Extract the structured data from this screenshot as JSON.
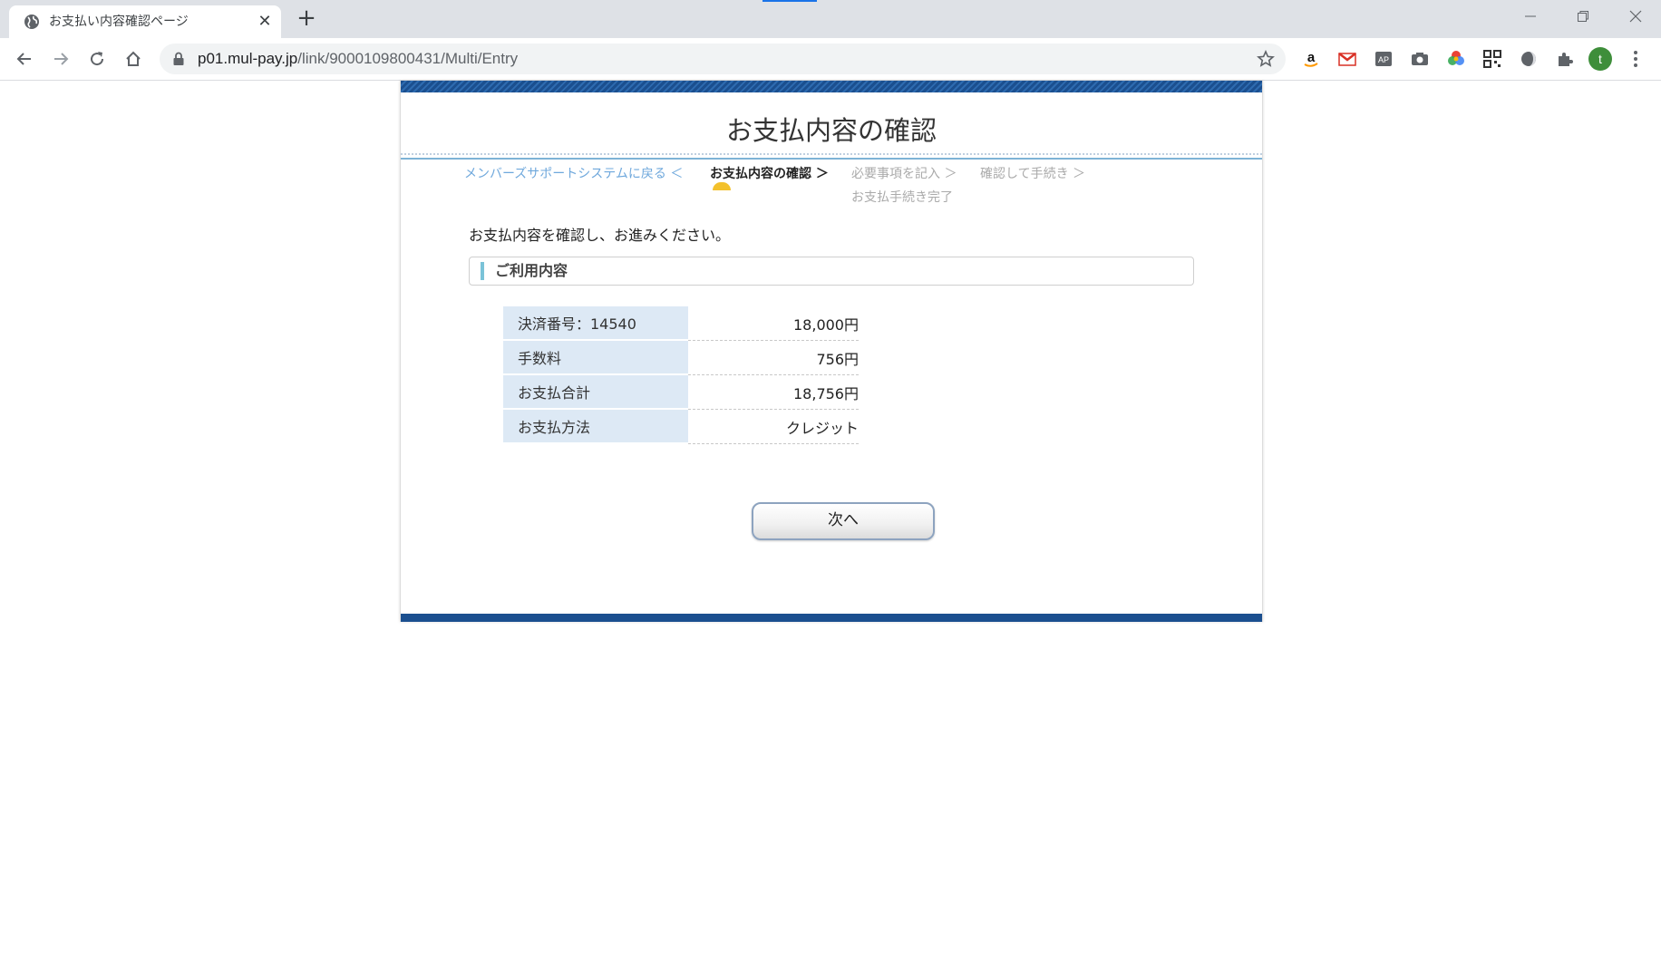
{
  "browser": {
    "tab_title": "お支払い内容確認ページ",
    "tab_close": "✕",
    "new_tab": "+",
    "url_host": "p01.mul-pay.jp",
    "url_path": "/link/9000109800431/Multi/Entry",
    "profile_initial": "t"
  },
  "page": {
    "title": "お支払内容の確認",
    "steps": {
      "back": "メンバーズサポートシステムに戻る ＜",
      "current": "お支払内容の確認 ＞",
      "step2": "必要事項を記入 ＞",
      "step3": "確認して手続き ＞",
      "step4": "お支払手続き完了"
    },
    "intro": "お支払内容を確認し、お進みください。",
    "section_title": "ご利用内容",
    "rows": [
      {
        "label": "決済番号：14540",
        "value": "18,000円"
      },
      {
        "label": "手数料",
        "value": "756円"
      },
      {
        "label": "お支払合計",
        "value": "18,756円"
      },
      {
        "label": "お支払方法",
        "value": "クレジット"
      }
    ],
    "next_button": "次へ"
  }
}
